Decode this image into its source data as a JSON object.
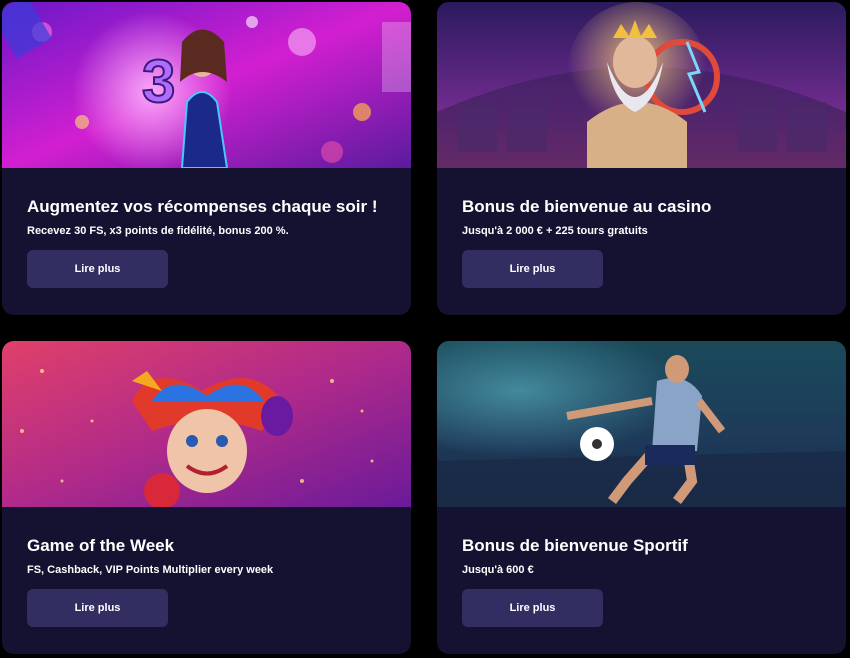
{
  "colors": {
    "page_bg": "#000000",
    "card_bg": "#141230",
    "button_bg": "#322e62",
    "text": "#ffffff"
  },
  "promotions": [
    {
      "title": "Augmentez vos récompenses chaque soir !",
      "subtitle": "Recevez 30 FS, x3 points de fidélité, bonus 200 %.",
      "button_label": "Lire plus",
      "image": "dancer-with-number-3-image"
    },
    {
      "title": "Bonus de bienvenue au casino",
      "subtitle": "Jusqu'à 2 000 € + 225 tours gratuits",
      "button_label": "Lire plus",
      "image": "zeus-casino-image"
    },
    {
      "title": "Game of the Week",
      "subtitle": "FS, Cashback, VIP Points Multiplier every week",
      "button_label": "Lire plus",
      "image": "jester-fruits-image"
    },
    {
      "title": "Bonus de bienvenue Sportif",
      "subtitle": "Jusqu'à 600 €",
      "button_label": "Lire plus",
      "image": "football-player-image"
    }
  ]
}
